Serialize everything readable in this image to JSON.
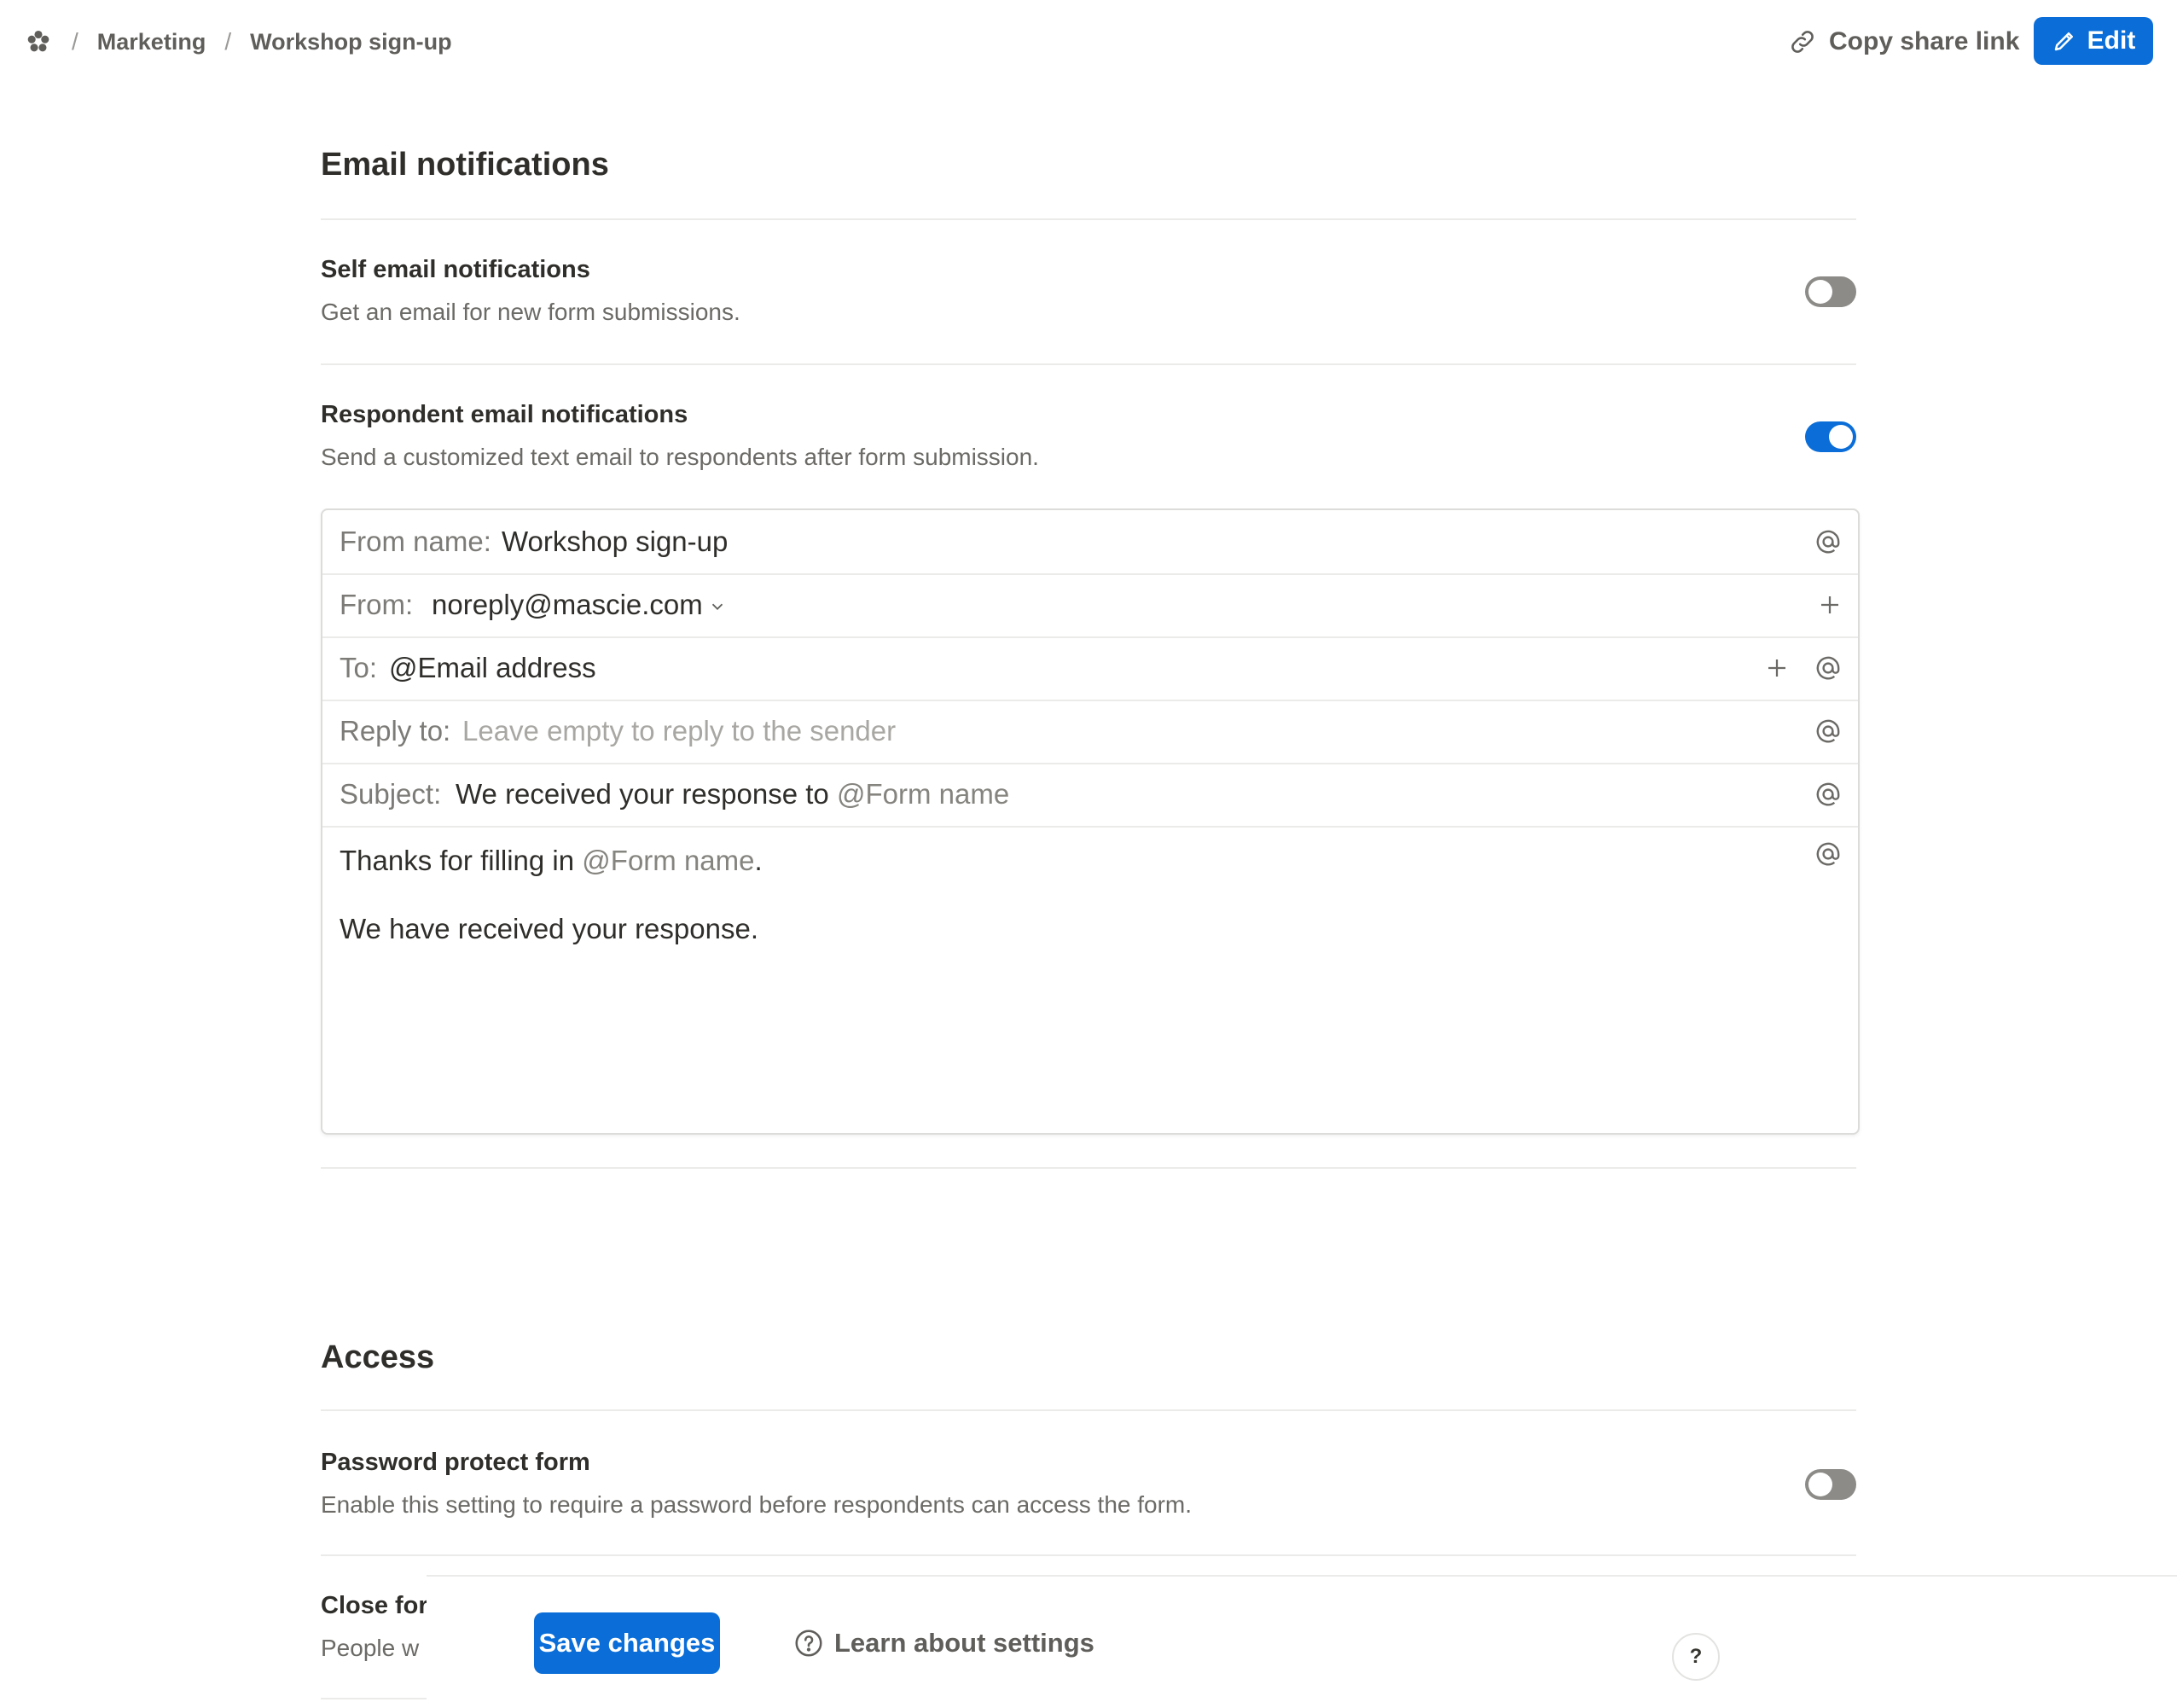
{
  "breadcrumb": {
    "logo_icon": "workspace-logo-icon",
    "items": [
      "Marketing",
      "Workshop sign-up"
    ],
    "separator": "/"
  },
  "header": {
    "copy_share_link_label": "Copy share link",
    "copy_share_link_icon": "link-icon",
    "edit_label": "Edit",
    "edit_icon": "pencil-icon"
  },
  "email_notifications": {
    "title": "Email notifications",
    "self": {
      "label": "Self email notifications",
      "description": "Get an email for new form submissions.",
      "enabled": false
    },
    "respondent": {
      "label": "Respondent email notifications",
      "description": "Send a customized text email to respondents after form submission.",
      "enabled": true
    },
    "email": {
      "from_name_label": "From name:",
      "from_name_value": "Workshop sign-up",
      "from_label": "From:",
      "from_value": "noreply@mascie.com",
      "to_label": "To:",
      "to_value": "@Email address",
      "reply_to_label": "Reply to:",
      "reply_to_placeholder": "Leave empty to reply to the sender",
      "subject_label": "Subject:",
      "subject_text": "We received your response to",
      "subject_mention": "@Form name",
      "body_line1_text": "Thanks for filling in",
      "body_line1_mention": "@Form name",
      "body_line1_end": ".",
      "body_line2": "We have received your response."
    }
  },
  "access": {
    "title": "Access",
    "password": {
      "label": "Password protect form",
      "description": "Enable this setting to require a password before respondents can access the form.",
      "enabled": false
    },
    "close_form": {
      "label_visible": "Close for",
      "description_visible": "People w"
    }
  },
  "footer": {
    "save_label": "Save changes",
    "learn_label": "Learn about settings",
    "learn_icon": "question-circle-icon",
    "help_label": "?"
  },
  "colors": {
    "accent": "#0b6ed8",
    "toggle_off": "#8c8b88",
    "text": "#2f2e2b",
    "muted": "#6b6a66"
  }
}
